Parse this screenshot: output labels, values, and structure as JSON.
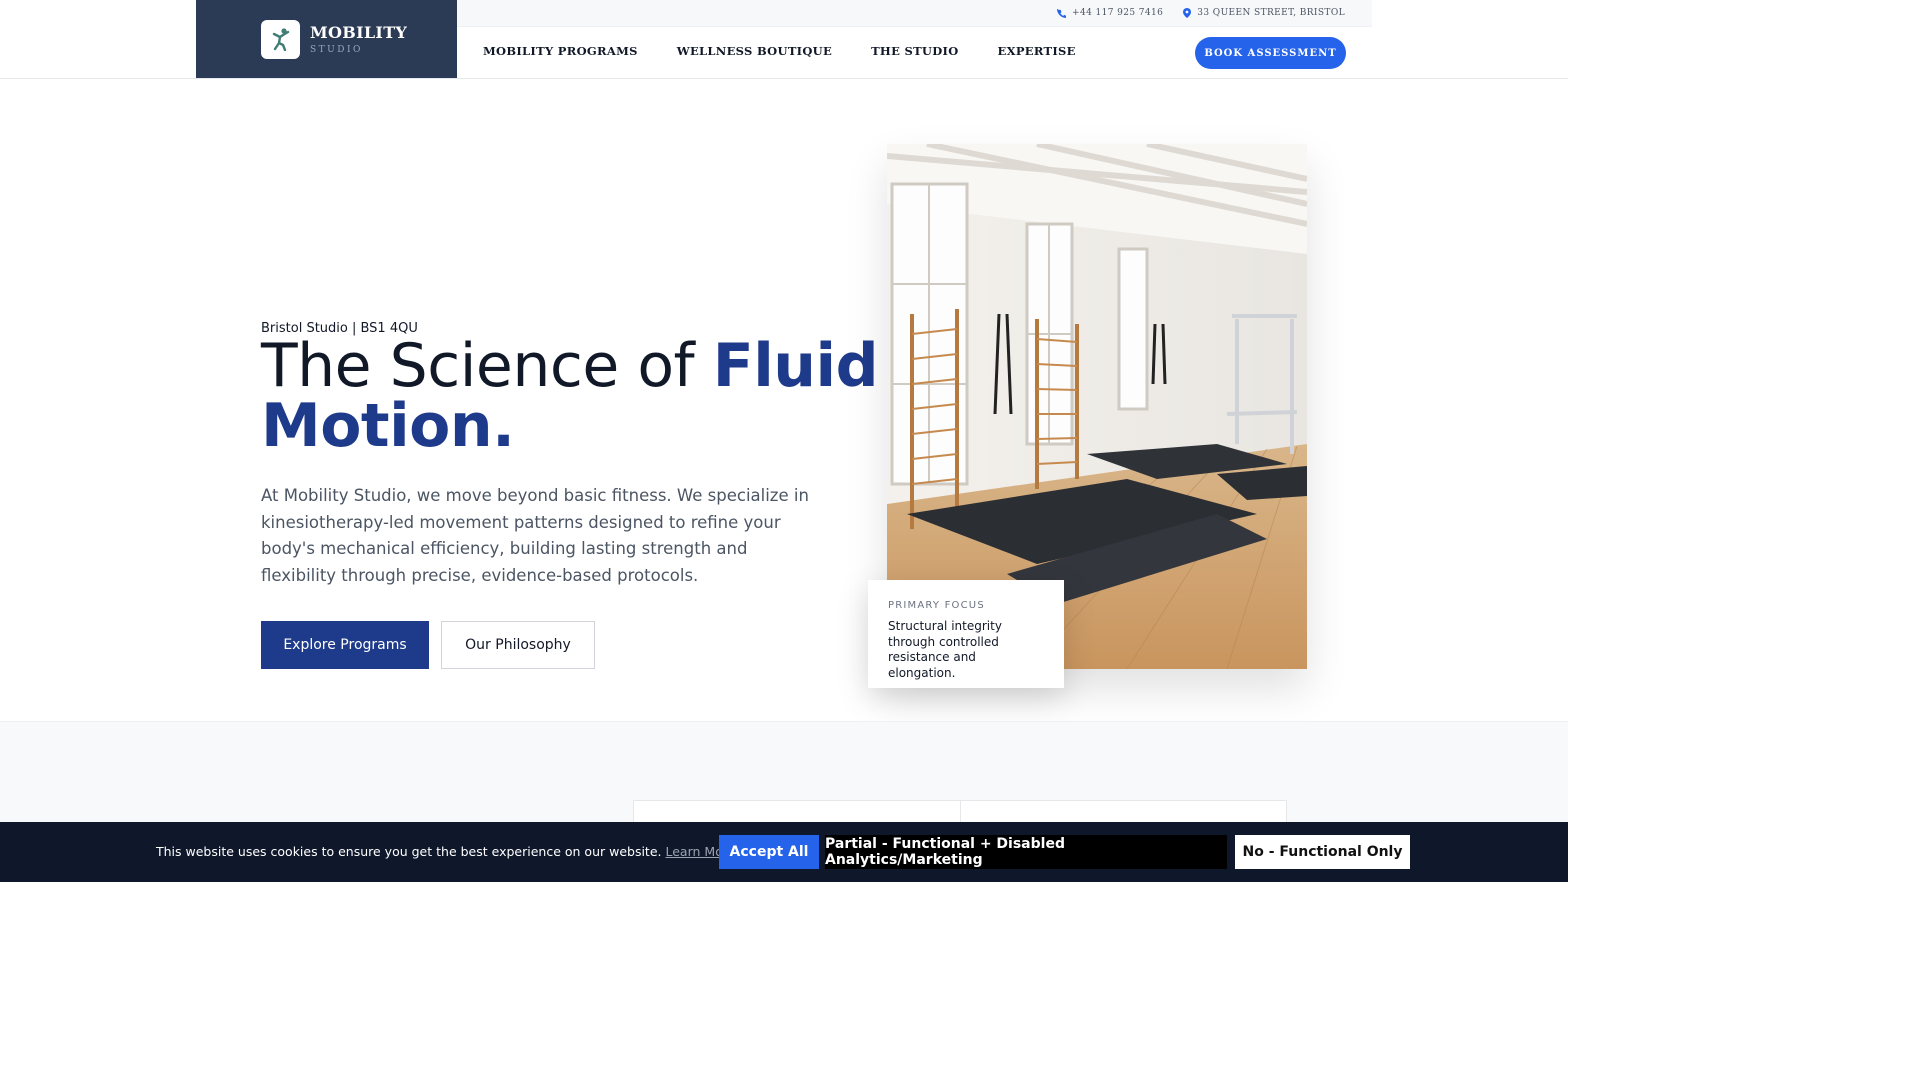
{
  "brand": {
    "name": "MOBILITY",
    "sub": "STUDIO",
    "logo_icon": "figure-stretch-icon",
    "color": "#2b3a55"
  },
  "topbar": {
    "phone": "+44 117 925 7416",
    "address": "33 QUEEN STREET, BRISTOL"
  },
  "nav": {
    "items": [
      "MOBILITY PROGRAMS",
      "WELLNESS BOUTIQUE",
      "THE STUDIO",
      "EXPERTISE"
    ],
    "cta": "BOOK ASSESSMENT"
  },
  "hero": {
    "eyebrow": "Bristol Studio | BS1 4QU",
    "title_light": "The Science of ",
    "title_bold_1": "Fluid",
    "title_bold_2": "Motion.",
    "description": "At Mobility Studio, we move beyond basic fitness. We specialize in kinesiotherapy-led movement patterns designed to refine your body's mechanical efficiency, building lasting strength and flexibility through precise, evidence-based protocols.",
    "primary_button": "Explore Programs",
    "secondary_button": "Our Philosophy",
    "focus_label": "PRIMARY FOCUS",
    "focus_text": "Structural integrity through controlled resistance and elongation."
  },
  "cookie": {
    "text": "This website uses cookies to ensure you get the best experience on our website.",
    "link": "Learn More",
    "accept": "Accept All",
    "partial": "Partial - Functional + Disabled Analytics/Marketing",
    "functional": "No - Functional Only"
  },
  "colors": {
    "accent": "#2563eb",
    "navy": "#1e3a8a",
    "dark": "#0f172a"
  }
}
